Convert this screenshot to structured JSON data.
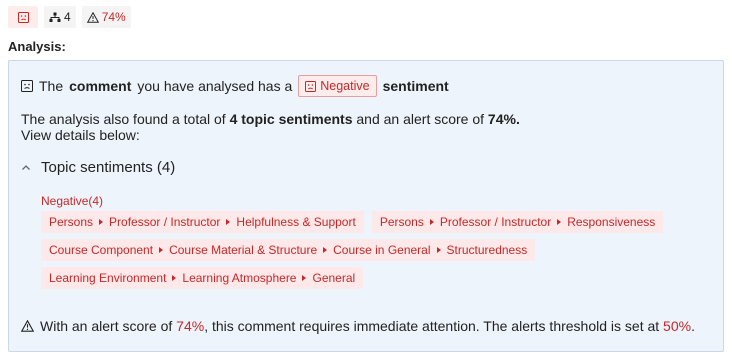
{
  "badges": {
    "count": "4",
    "alert": "74%"
  },
  "analysis_label": "Analysis:",
  "summary": {
    "prefix": "The",
    "subject": "comment",
    "middle": "you have analysed has a",
    "sentiment": "Negative",
    "suffix": "sentiment"
  },
  "details": {
    "line1_a": "The analysis also found a total of",
    "topic_count": "4 topic sentiments",
    "line1_b": "and an alert score of",
    "alert_score": "74%.",
    "line2": "View details below:"
  },
  "topics": {
    "heading": "Topic sentiments (4)",
    "negative_label": "Negative(4)",
    "tags": [
      [
        "Persons",
        "Professor / Instructor",
        "Helpfulness & Support"
      ],
      [
        "Persons",
        "Professor / Instructor",
        "Responsiveness"
      ],
      [
        "Course Component",
        "Course Material & Structure",
        "Course in General",
        "Structuredness"
      ],
      [
        "Learning Environment",
        "Learning Atmosphere",
        "General"
      ]
    ]
  },
  "footer": {
    "text_a": "With an alert score of",
    "score": "74%",
    "text_b": ", this comment requires immediate attention. The alerts threshold is set at",
    "threshold": "50%",
    "text_c": "."
  },
  "colors": {
    "negative": "#c62828",
    "panel_bg": "#eef4fb",
    "tag_bg": "#fde9e9"
  }
}
